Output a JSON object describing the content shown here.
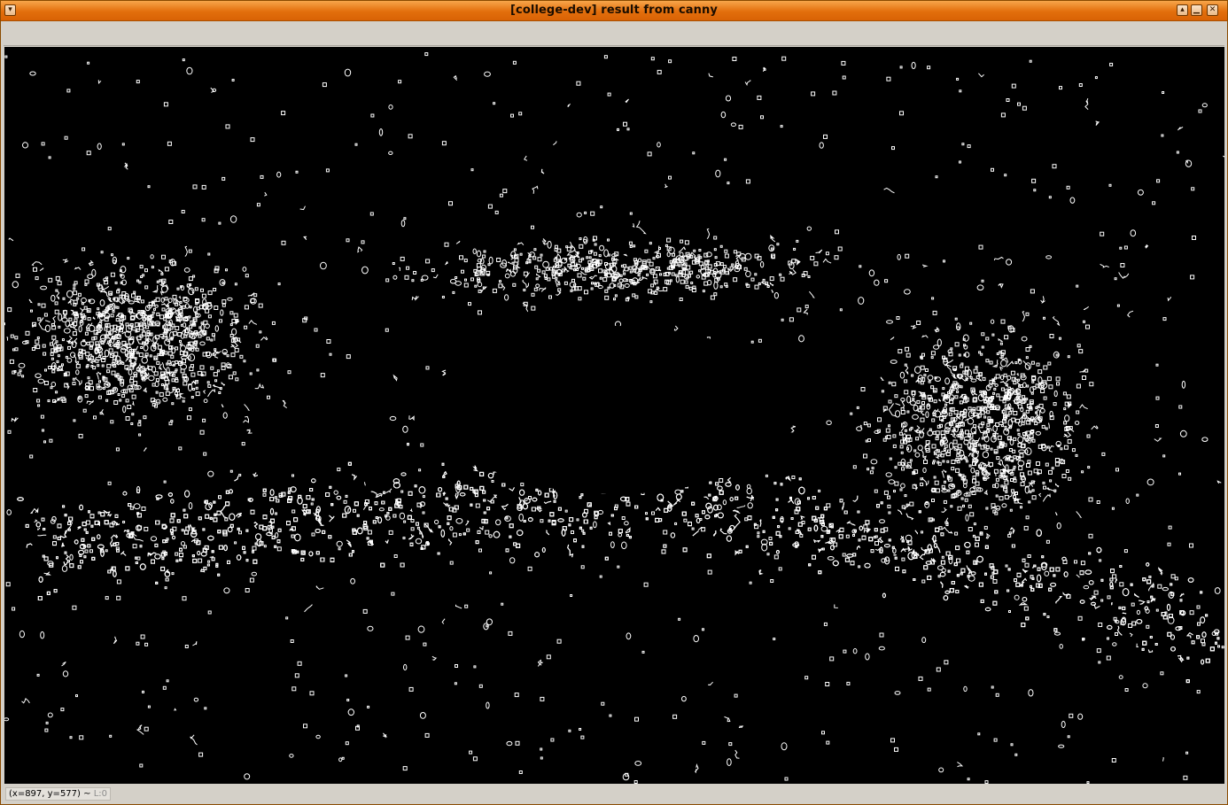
{
  "window": {
    "title": "[college-dev] result from canny",
    "buttons": {
      "menu": "▾",
      "shade": "▴",
      "minimize": "▁",
      "close": "✕"
    }
  },
  "status": {
    "coords": "(x=897, y=577) ~",
    "level": "L:0"
  },
  "colors": {
    "titlebar": "#e36f0c",
    "canvas_bg": "#000000",
    "edge": "#ffffff",
    "chrome": "#d4d0c8"
  }
}
